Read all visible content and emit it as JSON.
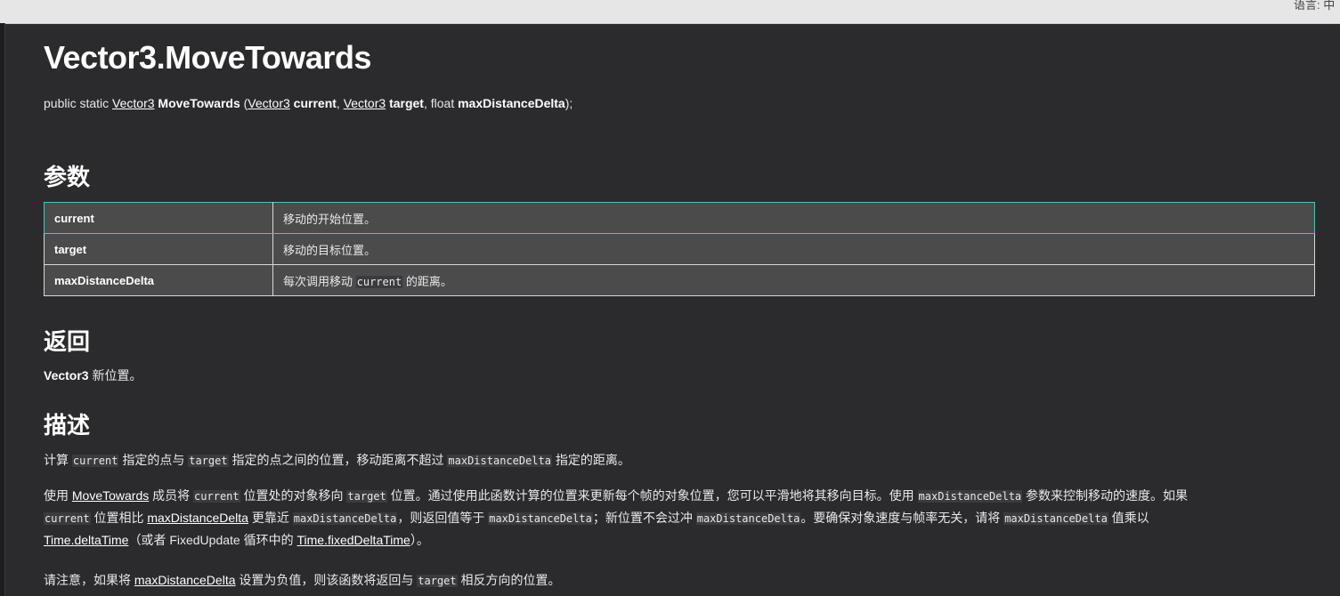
{
  "top_bar": {
    "language_label": "语言: 中"
  },
  "title": "Vector3.MoveTowards",
  "signature": {
    "prefix": "public static ",
    "return_type": "Vector3",
    "method": "MoveTowards",
    "open": " (",
    "p1_type": "Vector3",
    "p1_name": "current",
    "sep1": ", ",
    "p2_type": "Vector3",
    "p2_name": "target",
    "sep2": ", float ",
    "p3_name": "maxDistanceDelta",
    "close": ");"
  },
  "params_section": {
    "heading": "参数",
    "rows": [
      {
        "name": "current",
        "desc": "移动的开始位置。"
      },
      {
        "name": "target",
        "desc": "移动的目标位置。"
      },
      {
        "name": "maxDistanceDelta",
        "desc_pre": "每次调用移动 ",
        "desc_code": "current",
        "desc_post": " 的距离。"
      }
    ]
  },
  "returns_section": {
    "heading": "返回",
    "type": "Vector3",
    "text": " 新位置。"
  },
  "description_section": {
    "heading": "描述",
    "p1": {
      "t1": "计算 ",
      "c1": "current",
      "t2": " 指定的点与 ",
      "c2": "target",
      "t3": " 指定的点之间的位置，移动距离不超过 ",
      "c3": "maxDistanceDelta",
      "t4": " 指定的距离。"
    },
    "p2": {
      "t1": "使用 ",
      "l1": "MoveTowards",
      "t2": " 成员将 ",
      "c1": "current",
      "t3": " 位置处的对象移向 ",
      "c2": "target",
      "t4": " 位置。通过使用此函数计算的位置来更新每个帧的对象位置，您可以平滑地将其移向目标。使用 ",
      "c3": "maxDistanceDelta",
      "t5": " 参数来控制移动的速度。如果",
      "c4": "current",
      "t6": " 位置相比 ",
      "l2": "maxDistanceDelta",
      "t7": " 更靠近 ",
      "c5": "maxDistanceDelta",
      "t8": "，则返回值等于 ",
      "c6": "maxDistanceDelta",
      "t9": "；新位置不会过冲 ",
      "c7": "maxDistanceDelta",
      "t10": "。要确保对象速度与帧率无关，请将 ",
      "c8": "maxDistanceDelta",
      "t11": " 值乘以",
      "l3": "Time.deltaTime",
      "t12": "（或者 FixedUpdate 循环中的 ",
      "l4": "Time.fixedDeltaTime",
      "t13": "）。"
    },
    "p3": {
      "t1": "请注意，如果将 ",
      "l1": "maxDistanceDelta",
      "t2": " 设置为负值，则该函数将返回与 ",
      "c1": "target",
      "t3": " 相反方向的位置。"
    }
  }
}
